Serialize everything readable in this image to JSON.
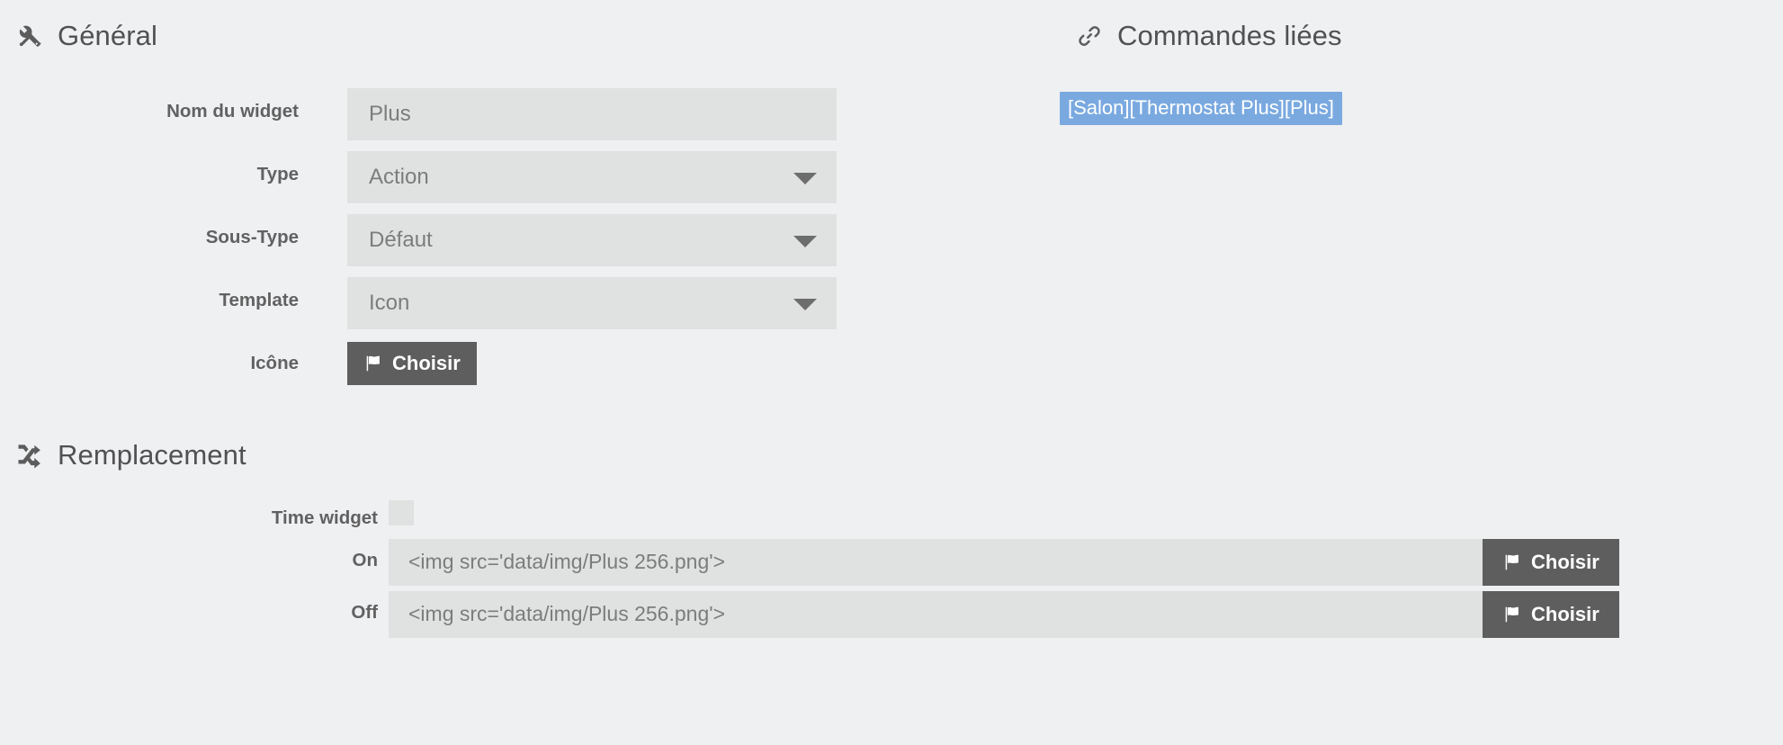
{
  "sections": {
    "general": {
      "title": "Général",
      "icon": "wrench-icon",
      "fields": {
        "widget_name": {
          "label": "Nom du widget",
          "value": "Plus"
        },
        "type": {
          "label": "Type",
          "value": "Action"
        },
        "sub_type": {
          "label": "Sous-Type",
          "value": "Défaut"
        },
        "template": {
          "label": "Template",
          "value": "Icon"
        },
        "icon": {
          "label": "Icône",
          "button_label": "Choisir",
          "button_icon": "flag-icon"
        }
      }
    },
    "linked_commands": {
      "title": "Commandes liées",
      "icon": "link-icon",
      "items": [
        {
          "label": "[Salon][Thermostat Plus][Plus]"
        }
      ]
    },
    "replacement": {
      "title": "Remplacement",
      "icon": "shuffle-icon",
      "fields": {
        "time_widget": {
          "label": "Time widget",
          "checked": false
        },
        "on": {
          "label": "On",
          "value": "<img src='data/img/Plus 256.png'>",
          "button_label": "Choisir",
          "button_icon": "flag-icon"
        },
        "off": {
          "label": "Off",
          "value": "<img src='data/img/Plus 256.png'>",
          "button_label": "Choisir",
          "button_icon": "flag-icon"
        }
      }
    }
  },
  "colors": {
    "page_background": "#eff0f2",
    "field_background": "#e0e2e1",
    "button_background": "#5e5e5e",
    "badge_background": "#7aa9e0",
    "label_text": "#616161",
    "value_text": "#7c7c7c",
    "heading_text": "#515151"
  }
}
